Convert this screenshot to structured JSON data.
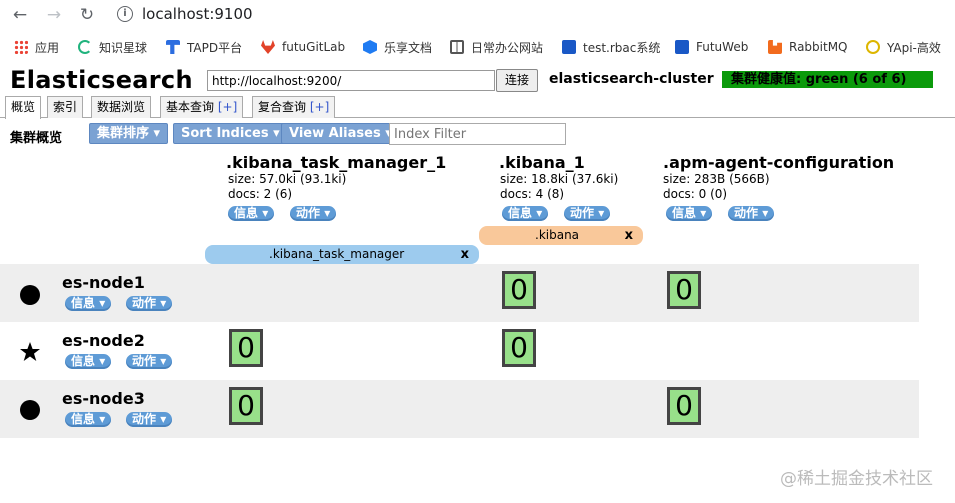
{
  "browser": {
    "url": "localhost:9100",
    "bookmarks": [
      {
        "label": "应用",
        "icon": "apps-grid-icon",
        "color": "#4285f4"
      },
      {
        "label": "知识星球",
        "icon": "zsxq-icon",
        "color": "#20b37d"
      },
      {
        "label": "TAPD平台",
        "icon": "tapd-icon",
        "color": "#2b6de0"
      },
      {
        "label": "futuGitLab",
        "icon": "gitlab-icon",
        "color": "#e24329"
      },
      {
        "label": "乐享文档",
        "icon": "lexiang-icon",
        "color": "#1f7bf2"
      },
      {
        "label": "日常办公网站",
        "icon": "book-icon",
        "color": "#555555"
      },
      {
        "label": "test.rbac系统",
        "icon": "rbac-icon",
        "color": "#1958c6"
      },
      {
        "label": "FutuWeb",
        "icon": "futuweb-icon",
        "color": "#1958c6"
      },
      {
        "label": "RabbitMQ",
        "icon": "rabbitmq-icon",
        "color": "#f26b1d"
      },
      {
        "label": "YApi-高效",
        "icon": "yapi-icon",
        "color": "#ddb600"
      }
    ]
  },
  "app": {
    "title": "Elasticsearch",
    "connect_url": "http://localhost:9200/",
    "connect_label": "连接",
    "cluster_name": "elasticsearch-cluster",
    "health": "集群健康值: green (6 of 6)",
    "health_color": "#0b9a0b"
  },
  "tabs": [
    {
      "label": "概览",
      "plus": ""
    },
    {
      "label": "索引",
      "plus": ""
    },
    {
      "label": "数据浏览",
      "plus": ""
    },
    {
      "label": "基本查询",
      "plus": "[+]"
    },
    {
      "label": "复合查询",
      "plus": "[+]"
    }
  ],
  "toolbar": {
    "label": "集群概览",
    "sort_cluster": "集群排序",
    "sort_indices": "Sort Indices",
    "view_aliases": "View Aliases",
    "filter_placeholder": "Index Filter"
  },
  "pill_labels": {
    "info": "信息",
    "action": "动作"
  },
  "indices": [
    {
      "name": ".kibana_task_manager_1",
      "size": "size: 57.0ki (93.1ki)",
      "docs": "docs: 2 (6)"
    },
    {
      "name": ".kibana_1",
      "size": "size: 18.8ki (37.6ki)",
      "docs": "docs: 4 (8)"
    },
    {
      "name": ".apm-agent-configuration",
      "size": "size: 283B (566B)",
      "docs": "docs: 0 (0)"
    }
  ],
  "aliases": [
    {
      "name": ".kibana_task_manager",
      "close": "x",
      "color": "#9dcbee"
    },
    {
      "name": ".kibana",
      "close": "x",
      "color": "#f9c89a"
    }
  ],
  "nodes": [
    {
      "name": "es-node1",
      "icon": "circle-icon",
      "shards": [
        "",
        "0",
        "0"
      ]
    },
    {
      "name": "es-node2",
      "icon": "star-icon",
      "shards": [
        "0",
        "0",
        ""
      ]
    },
    {
      "name": "es-node3",
      "icon": "circle-icon",
      "shards": [
        "0",
        "",
        "0"
      ]
    }
  ],
  "watermark": "@稀土掘金技术社区"
}
